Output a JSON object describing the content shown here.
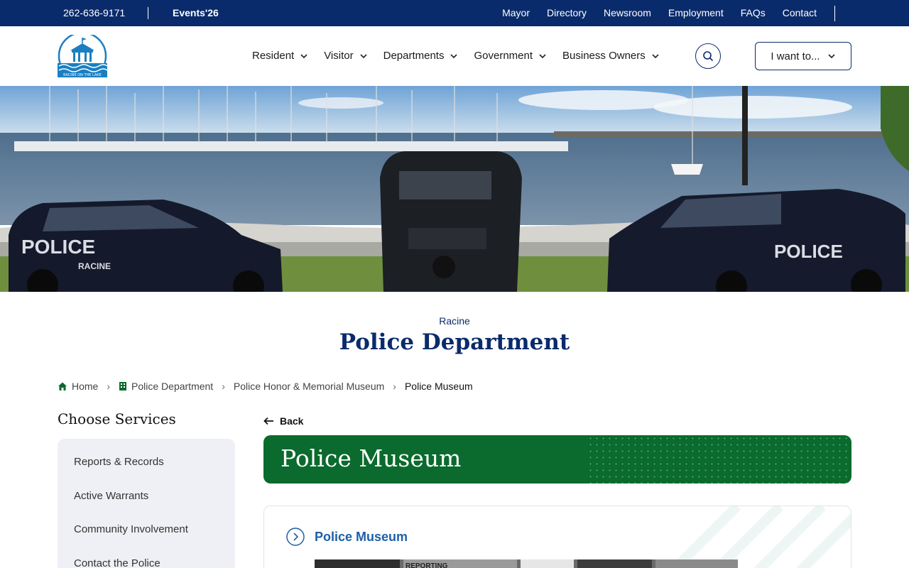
{
  "utility": {
    "phone": "262-636-9171",
    "events": "Events'26",
    "links": [
      "Mayor",
      "Directory",
      "Newsroom",
      "Employment",
      "FAQs",
      "Contact"
    ]
  },
  "header": {
    "logo_text": "RACINE ON THE LAKE",
    "nav": [
      "Resident",
      "Visitor",
      "Departments",
      "Government",
      "Business Owners"
    ],
    "i_want_to": "I want to..."
  },
  "hero": {
    "vehicle_text_left": "POLICE",
    "vehicle_text_right": "POLICE",
    "vehicle_sub": "RACINE"
  },
  "title": {
    "eyebrow": "Racine",
    "heading": "Police Department"
  },
  "breadcrumb": {
    "home": "Home",
    "dept": "Police Department",
    "museum_parent": "Police Honor & Memorial Museum",
    "current": "Police Museum"
  },
  "sidebar": {
    "title": "Choose Services",
    "items": [
      "Reports & Records",
      "Active Warrants",
      "Community Involvement",
      "Contact the Police"
    ]
  },
  "main": {
    "back": "Back",
    "banner_title": "Police Museum",
    "card_title": "Police Museum",
    "photo_caption": "REPORTING"
  },
  "colors": {
    "navy": "#0a2b6b",
    "green": "#0b6a2d",
    "link_blue": "#1d5fa8",
    "sidebar_bg": "#eef0f5"
  }
}
